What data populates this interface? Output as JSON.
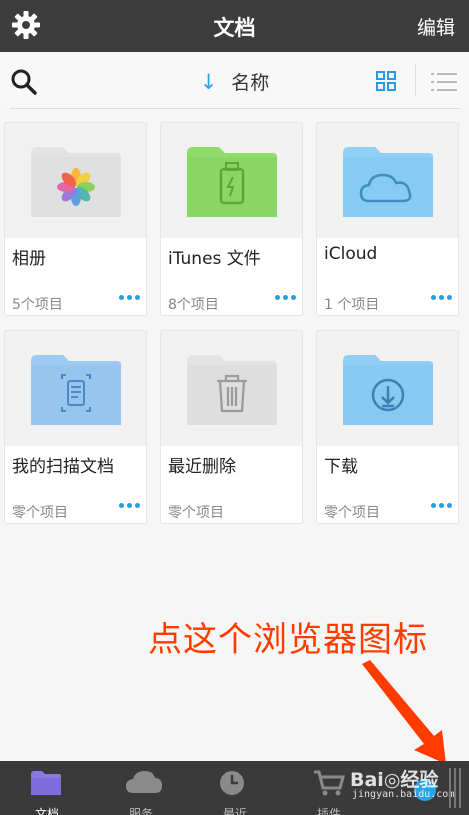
{
  "header": {
    "title": "文档",
    "edit_label": "编辑"
  },
  "toolbar": {
    "sort_arrow": "↓",
    "sort_label": "名称"
  },
  "folders": [
    {
      "name": "相册",
      "count": "5个项目",
      "icon": "photos-folder-icon",
      "color": "#e3e3e3"
    },
    {
      "name": "iTunes 文件",
      "count": "8个项目",
      "icon": "itunes-usb-folder-icon",
      "color": "#8fdc6a"
    },
    {
      "name": "iCloud",
      "count": "1 个项目",
      "icon": "icloud-folder-icon",
      "color": "#8fd0f4"
    },
    {
      "name": "我的扫描文档",
      "count": "零个项目",
      "icon": "scan-folder-icon",
      "color": "#9ccaf0"
    },
    {
      "name": "最近删除",
      "count": "零个项目",
      "icon": "trash-folder-icon",
      "color": "#e3e3e3"
    },
    {
      "name": "下载",
      "count": "零个项目",
      "icon": "download-folder-icon",
      "color": "#8fcdf2"
    }
  ],
  "annotation": {
    "text": "点这个浏览器图标"
  },
  "tabbar": {
    "tabs": [
      {
        "label": "文档",
        "icon": "folder-icon",
        "active": true
      },
      {
        "label": "服务",
        "icon": "cloud-icon",
        "active": false
      },
      {
        "label": "最近",
        "icon": "clock-icon",
        "active": false
      },
      {
        "label": "插件",
        "icon": "cart-icon",
        "active": false
      }
    ]
  },
  "watermark": {
    "text": "Bai◎经验",
    "sub": "jingyan.baidu.com"
  },
  "colors": {
    "accent": "#2a9be0",
    "annotation": "#ff3b00",
    "nav_bg": "#3d3d3d"
  }
}
